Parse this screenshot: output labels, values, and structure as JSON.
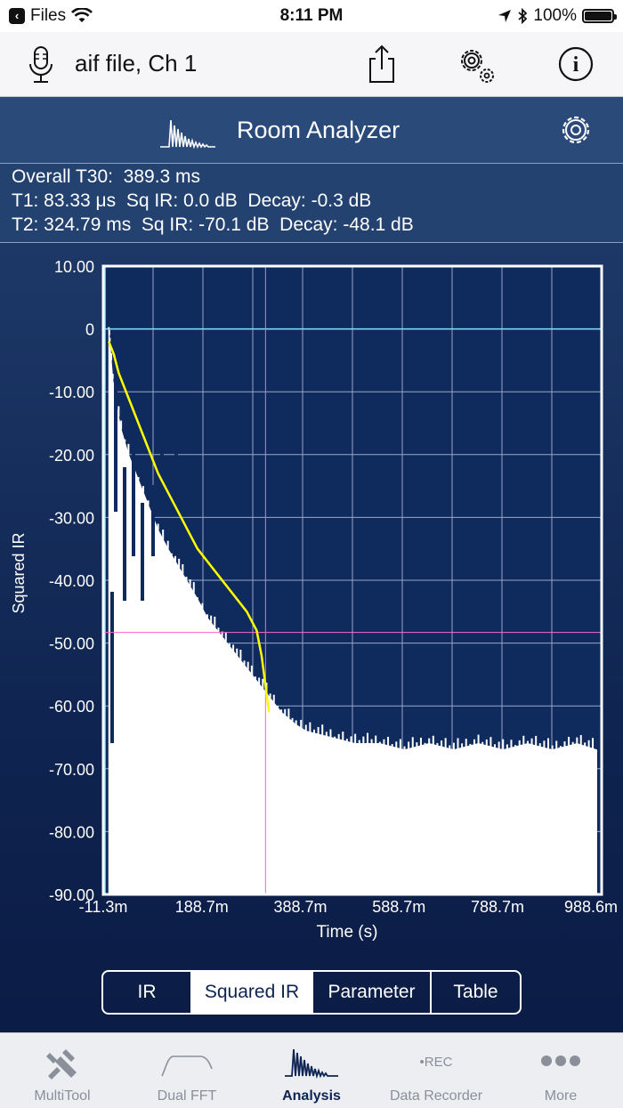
{
  "status_bar": {
    "back_app": "Files",
    "time": "8:11 PM",
    "battery": "100%",
    "battery_level": 1.0
  },
  "toolbar": {
    "title": "aif file, Ch 1",
    "icons": [
      "microphone-icon",
      "share-icon",
      "settings-gears-icon",
      "info-icon"
    ]
  },
  "panel": {
    "title": "Room Analyzer",
    "icons": [
      "waveform-icon",
      "gear-icon"
    ]
  },
  "readouts": {
    "overall": "Overall T30:  389.3 ms",
    "t1": "T1: 83.33 μs  Sq IR: 0.0 dB  Decay: -0.3 dB",
    "t2": "T2: 324.79 ms  Sq IR: -70.1 dB  Decay: -48.1 dB"
  },
  "chart_data": {
    "type": "area",
    "title": "",
    "xlabel": "Time (s)",
    "ylabel": "Squared IR",
    "xlim": [
      -0.0113,
      1.0
    ],
    "ylim": [
      -90,
      10
    ],
    "x_tick_labels": [
      "-11.3m",
      "188.7m",
      "388.7m",
      "588.7m",
      "788.7m",
      "988.6m"
    ],
    "x_tick_values": [
      -0.0113,
      0.1887,
      0.3887,
      0.5887,
      0.7887,
      0.9886
    ],
    "y_tick_labels": [
      "10.00",
      "0",
      "-10.00",
      "-20.00",
      "-30.00",
      "-40.00",
      "-50.00",
      "-60.00",
      "-70.00",
      "-80.00",
      "-90.00"
    ],
    "y_tick_values": [
      10,
      0,
      -10,
      -20,
      -30,
      -40,
      -50,
      -60,
      -70,
      -80,
      -90
    ],
    "grid": true,
    "colors": {
      "squared_ir": "#ffffff",
      "decay_fit": "#ffff00",
      "zero_line": "#7fe0ff",
      "cursor": "#ff66cc",
      "grid": "#9aa8c8"
    },
    "series": [
      {
        "values_x": [
          0.0,
          0.002,
          0.008,
          0.015,
          0.025,
          0.04,
          0.06,
          0.08,
          0.1,
          0.12,
          0.15,
          0.18,
          0.2,
          0.23,
          0.26,
          0.29,
          0.32,
          0.35,
          0.38,
          0.4,
          0.45,
          0.5,
          0.55,
          0.6,
          0.65,
          0.7,
          0.75,
          0.8,
          0.85,
          0.9,
          0.95,
          0.99
        ],
        "values_y": [
          0,
          -2,
          -8,
          -12,
          -16,
          -20,
          -24,
          -28,
          -32,
          -35,
          -39,
          -43,
          -46,
          -49,
          -52,
          -55,
          -58,
          -61,
          -63,
          -64,
          -65,
          -66,
          -66,
          -67,
          -66,
          -67,
          -66,
          -67,
          -66,
          -67,
          -66,
          -67
        ]
      },
      {
        "values_x": [
          0.0,
          0.01,
          0.02,
          0.04,
          0.06,
          0.08,
          0.1,
          0.12,
          0.14,
          0.16,
          0.18,
          0.2,
          0.22,
          0.24,
          0.26,
          0.28,
          0.3,
          0.31,
          0.32,
          0.325
        ],
        "values_y": [
          -2,
          -4,
          -7,
          -11,
          -15,
          -19,
          -23,
          -26,
          -29,
          -32,
          -35,
          -37,
          -39,
          -41,
          -43,
          -45,
          -48,
          -52,
          -58,
          -61
        ]
      }
    ],
    "cursor": {
      "x": 0.318,
      "y": -48.3
    }
  },
  "segments": [
    {
      "label": "IR",
      "active": false
    },
    {
      "label": "Squared IR",
      "active": true
    },
    {
      "label": "Parameter",
      "active": false
    },
    {
      "label": "Table",
      "active": false
    }
  ],
  "tabs": [
    {
      "label": "MultiTool",
      "icon": "multitool-icon",
      "active": false
    },
    {
      "label": "Dual FFT",
      "icon": "dual-fft-icon",
      "active": false
    },
    {
      "label": "Analysis",
      "icon": "analysis-icon",
      "active": true
    },
    {
      "label": "Data Recorder",
      "icon": "rec-icon",
      "badge": "•REC",
      "active": false
    },
    {
      "label": "More",
      "icon": "more-icon",
      "active": false
    }
  ]
}
